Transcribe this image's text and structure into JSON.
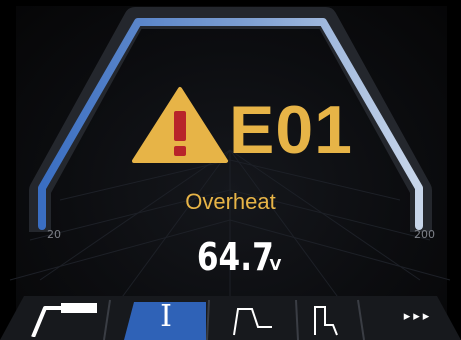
{
  "status": {
    "error_code": "E01",
    "error_message": "Overheat"
  },
  "reading": {
    "value": "64.7",
    "unit": "V"
  },
  "scale": {
    "min_label": "20",
    "max_label": "200"
  },
  "toolbar": {
    "current_mode_glyph": "I",
    "more_glyph": "▸▸▸"
  },
  "colors": {
    "warning": "#e7b447",
    "arc_start": "#3a6ec2",
    "arc_end": "#c8d6ea",
    "active_tab": "#2f62b7"
  },
  "icons": {
    "warning": "warning-triangle-icon",
    "torch": "welding-torch-icon",
    "rise": "ramp-up-icon",
    "step": "step-down-icon",
    "more": "more-arrows-icon"
  }
}
